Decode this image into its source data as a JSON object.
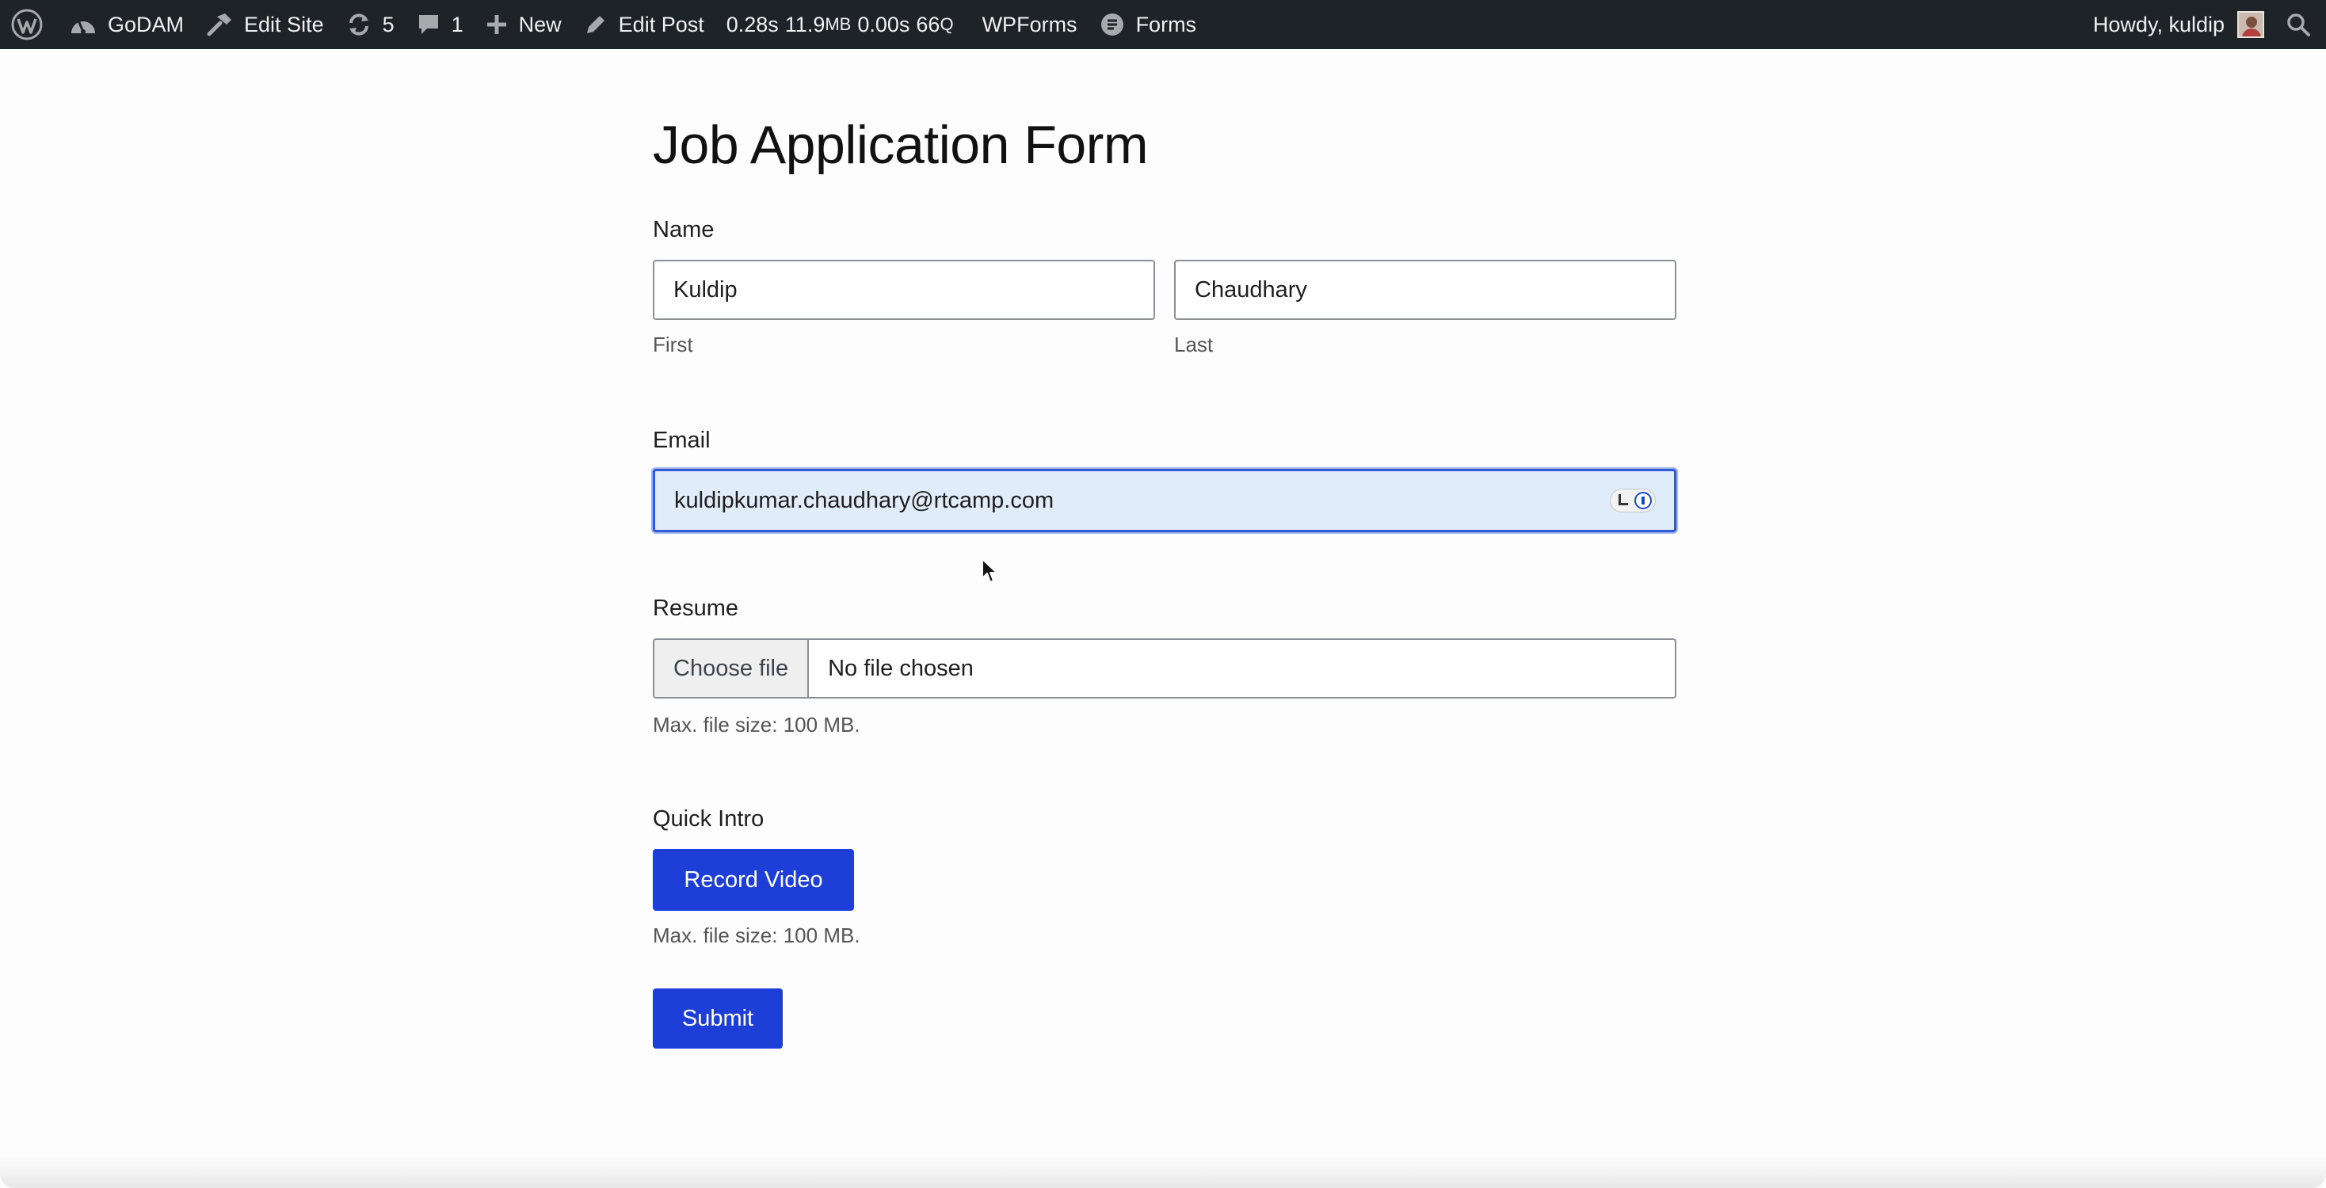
{
  "adminbar": {
    "site": "GoDAM",
    "edit_site": "Edit Site",
    "updates_count": "5",
    "comments_count": "1",
    "new": "New",
    "edit_post": "Edit Post",
    "stats": {
      "time": "0.28s",
      "memory_value": "11.9",
      "memory_unit": "MB",
      "query_time": "0.00s",
      "queries_value": "66",
      "queries_unit": "Q"
    },
    "wpforms": "WPForms",
    "forms": "Forms",
    "howdy": "Howdy, kuldip",
    "colors": {
      "bar_bg": "#1d2327",
      "text": "#f0f0f1"
    }
  },
  "form": {
    "title": "Job Application Form",
    "name": {
      "label": "Name",
      "first_value": "Kuldip",
      "first_sublabel": "First",
      "last_value": "Chaudhary",
      "last_sublabel": "Last"
    },
    "email": {
      "label": "Email",
      "value": "kuldipkumar.chaudhary@rtcamp.com"
    },
    "resume": {
      "label": "Resume",
      "choose_label": "Choose file",
      "status": "No file chosen",
      "hint": "Max. file size: 100 MB."
    },
    "quick_intro": {
      "label": "Quick Intro",
      "button": "Record Video",
      "hint": "Max. file size: 100 MB."
    },
    "submit": "Submit",
    "colors": {
      "accent": "#1d3fd8",
      "focus_bg": "#e1ecfa",
      "focus_border": "#2f5bd7"
    }
  }
}
